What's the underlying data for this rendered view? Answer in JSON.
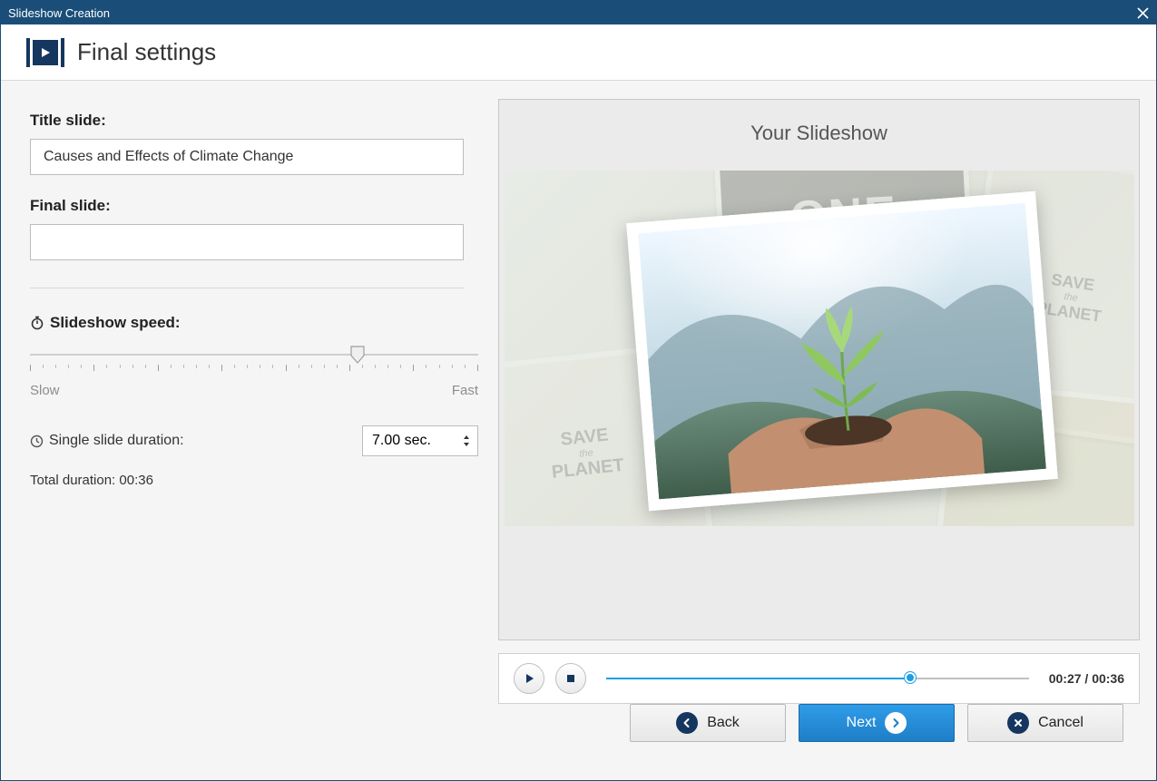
{
  "window": {
    "title": "Slideshow Creation"
  },
  "header": {
    "title": "Final settings"
  },
  "left": {
    "title_slide_label": "Title slide:",
    "title_slide_value": "Causes and Effects of Climate Change",
    "final_slide_label": "Final slide:",
    "final_slide_value": "",
    "speed_label": "Slideshow speed:",
    "speed_slow": "Slow",
    "speed_fast": "Fast",
    "slide_duration_label": "Single slide duration:",
    "slide_duration_value": "7.00 sec.",
    "total_duration_label": "Total duration: 00:36"
  },
  "preview": {
    "title": "Your Slideshow",
    "bg_one": "ONE",
    "bg_planet_1": "SAVE",
    "bg_planet_2": "PLANET",
    "bg_planet_mid": "the"
  },
  "player": {
    "current_time": "00:27",
    "total_time": "00:36",
    "time_sep": " / "
  },
  "footer": {
    "back": "Back",
    "next": "Next",
    "cancel": "Cancel"
  }
}
